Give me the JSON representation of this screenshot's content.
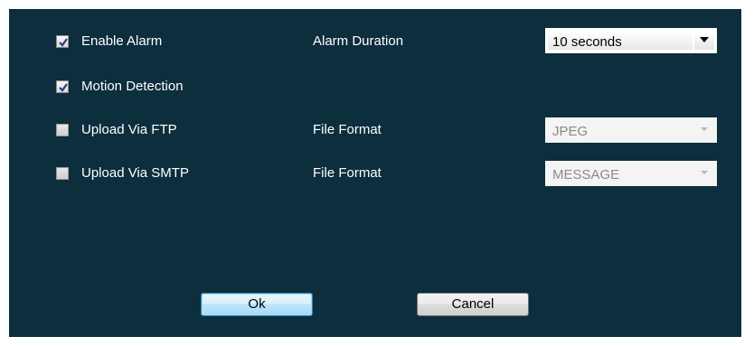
{
  "settings": {
    "enable_alarm": {
      "label": "Enable Alarm",
      "checked": true
    },
    "motion_detection": {
      "label": "Motion Detection",
      "checked": true
    },
    "upload_ftp": {
      "label": "Upload Via FTP",
      "checked": false
    },
    "upload_smtp": {
      "label": "Upload Via SMTP",
      "checked": false
    }
  },
  "alarm_duration": {
    "label": "Alarm Duration",
    "value": "10 seconds"
  },
  "ftp_format": {
    "label": "File Format",
    "value": "JPEG",
    "disabled": true
  },
  "smtp_format": {
    "label": "File Format",
    "value": "MESSAGE",
    "disabled": true
  },
  "buttons": {
    "ok": "Ok",
    "cancel": "Cancel"
  },
  "colors": {
    "panel_bg": "#0c2e3d",
    "text": "#ffffff",
    "check_mark": "#2a3f8f"
  }
}
